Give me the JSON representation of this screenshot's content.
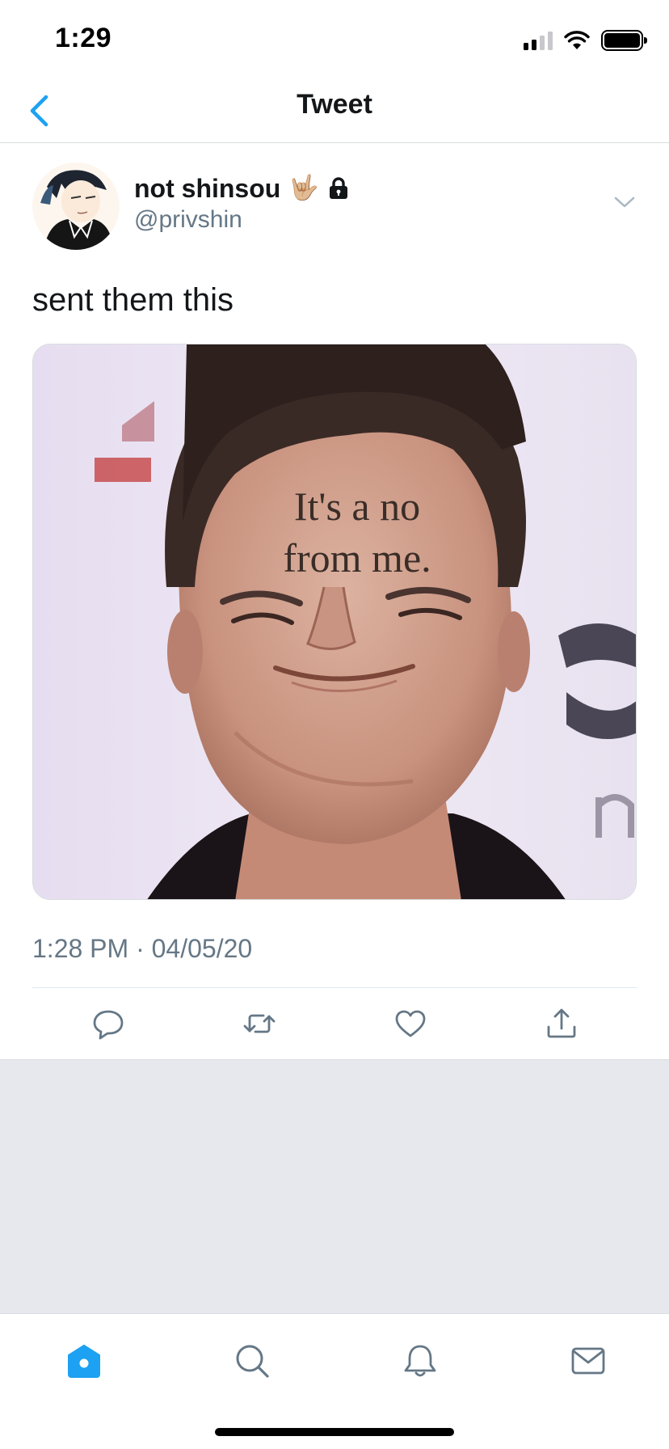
{
  "status_bar": {
    "time": "1:29",
    "icons": [
      "cellular-signal-icon",
      "wifi-icon",
      "battery-icon"
    ]
  },
  "nav": {
    "title": "Tweet",
    "back_icon": "chevron-left-icon"
  },
  "tweet": {
    "author": {
      "display_name": "not shinsou",
      "emoji": "🤟🏼",
      "protected_icon": "lock-icon",
      "handle": "@privshin"
    },
    "text": "sent them this",
    "media": {
      "caption_line_1": "It's a no",
      "caption_line_2": "from me."
    },
    "timestamp": "1:28 PM · 04/05/20",
    "actions": [
      "reply-icon",
      "retweet-icon",
      "like-icon",
      "share-icon"
    ]
  },
  "tab_bar": {
    "tabs": [
      "home-icon",
      "search-icon",
      "notifications-icon",
      "messages-icon"
    ],
    "active_tab": "home-icon"
  },
  "colors": {
    "accent": "#1da1f2",
    "text_primary": "#14171a",
    "text_secondary": "#657786",
    "divider": "#d9dde1",
    "background_gray": "#e6e8ee"
  }
}
